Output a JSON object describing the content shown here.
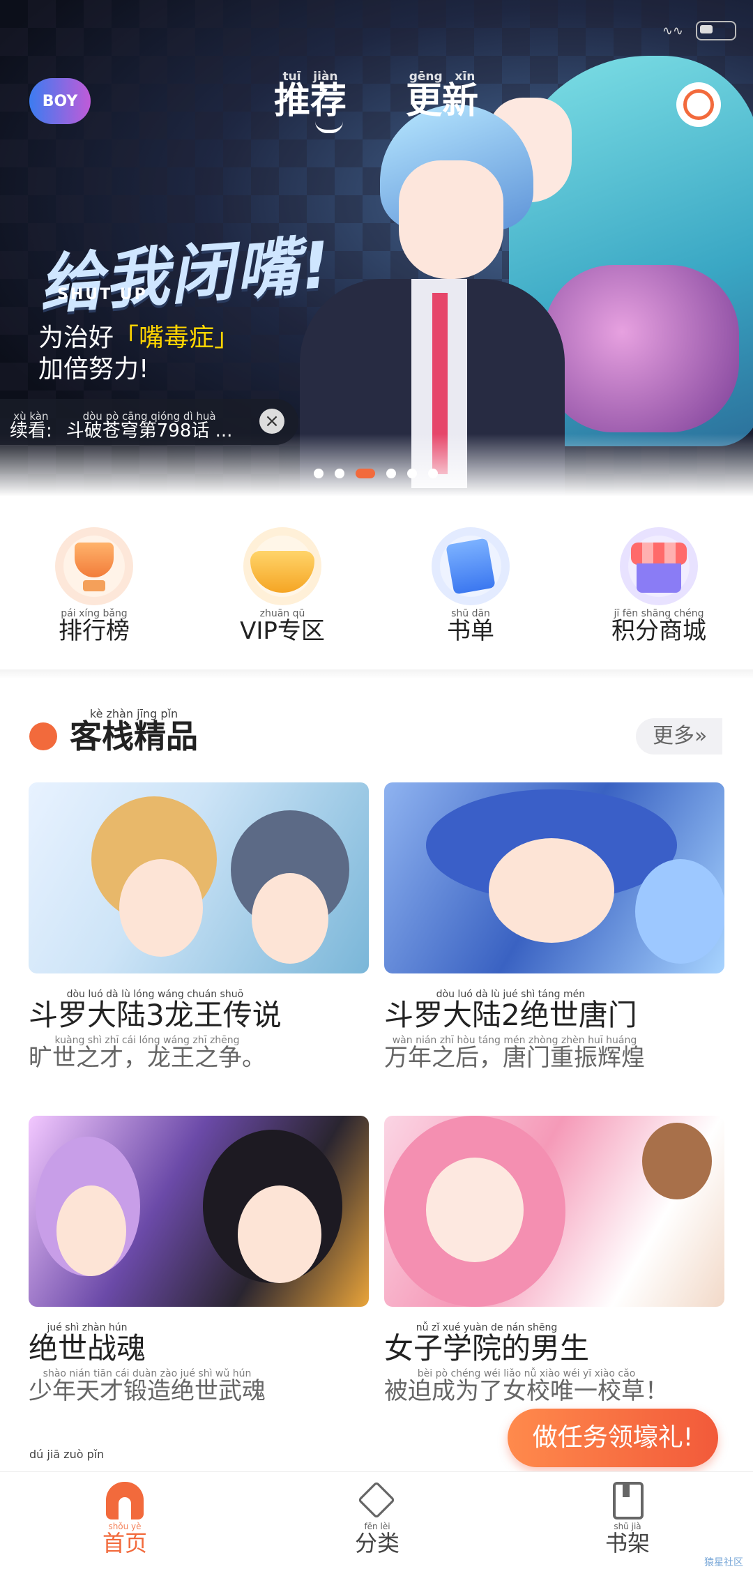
{
  "header": {
    "gender_toggle": "BOY",
    "tabs": [
      {
        "label": "推荐",
        "pinyin": [
          "tuī",
          "jiàn"
        ]
      },
      {
        "label": "更新",
        "pinyin": [
          "gēng",
          "xīn"
        ]
      }
    ]
  },
  "banner": {
    "title": "给我闭嘴!",
    "subtitle": "SHUT UP",
    "tagline_prefix": "为治好",
    "tagline_highlight": "「嘴毒症」",
    "tagline_2": "加倍努力!",
    "continue_label": "续看:",
    "continue_label_pinyin": "xù kàn",
    "continue_value": "斗破苍穹第798话 ...",
    "continue_value_pinyin": "dòu pò cāng qióng dì huà",
    "carousel_count": 6,
    "carousel_active": 2
  },
  "quick_links": [
    {
      "label": "排行榜",
      "pinyin": "pái xíng bǎng",
      "icon": "trophy-icon"
    },
    {
      "label": "VIP专区",
      "pinyin": "zhuān qū",
      "icon": "crown-icon"
    },
    {
      "label": "书单",
      "pinyin": "shū dān",
      "icon": "book-list-icon"
    },
    {
      "label": "积分商城",
      "pinyin": "jī fēn shāng chéng",
      "icon": "shop-icon"
    }
  ],
  "section": {
    "title": "客栈精品",
    "pinyin": "kè zhàn jīng pǐn",
    "more": "更多"
  },
  "cards": [
    {
      "title": "斗罗大陆3龙王传说",
      "title_pinyin": "dòu luó dà lù lóng wáng chuán shuō",
      "desc": "旷世之才，龙王之争。",
      "desc_pinyin": "kuàng shì zhī cái lóng wáng zhī zhēng"
    },
    {
      "title": "斗罗大陆2绝世唐门",
      "title_pinyin": "dòu luó dà lù jué shì táng mén",
      "desc": "万年之后，唐门重振辉煌",
      "desc_pinyin": "wàn nián zhī hòu táng mén zhòng zhèn huī huáng"
    },
    {
      "title": "绝世战魂",
      "title_pinyin": "jué shì zhàn hún",
      "desc": "少年天才锻造绝世武魂",
      "desc_pinyin": "shào nián tiān cái duàn zào jué shì wǔ hún"
    },
    {
      "title": "女子学院的男生",
      "title_pinyin": "nǚ zǐ xué yuàn de nán shēng",
      "desc": "被迫成为了女校唯一校草！",
      "desc_pinyin": "bèi pò chéng wéi liǎo nǚ xiào wéi yī xiào cǎo"
    }
  ],
  "task_button": "做任务领壕礼!",
  "next_section_pinyin": "dú jiā zuò pǐn",
  "bottom_nav": [
    {
      "label": "首页",
      "pinyin": "shǒu yè",
      "icon": "home-icon",
      "active": true
    },
    {
      "label": "分类",
      "pinyin": "fēn lèi",
      "icon": "category-icon",
      "active": false
    },
    {
      "label": "书架",
      "pinyin": "shū jià",
      "icon": "bookshelf-icon",
      "active": false
    }
  ],
  "watermark": "猿星社区",
  "colors": {
    "accent": "#f26a3c",
    "text": "#222222",
    "muted": "#666666"
  }
}
